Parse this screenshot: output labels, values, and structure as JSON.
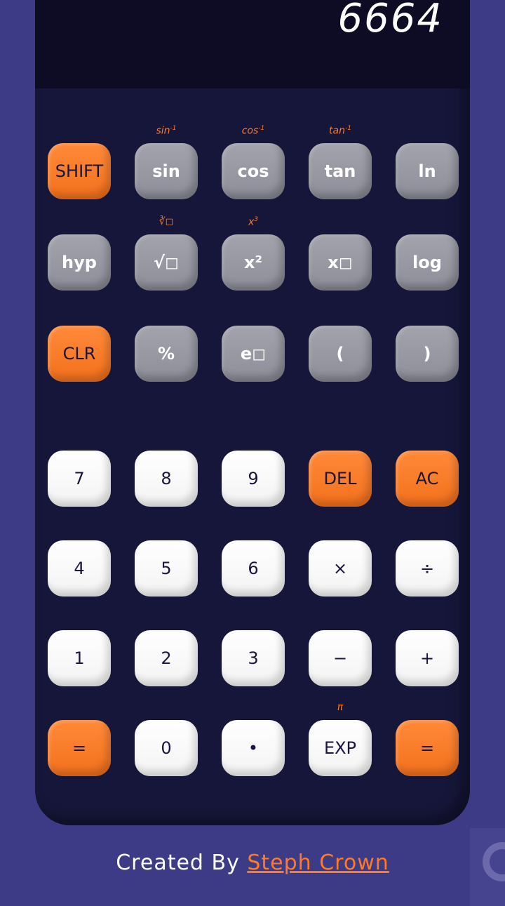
{
  "display": {
    "value": "6664"
  },
  "scientific_rows": [
    [
      {
        "label": "SHIFT",
        "style": "orange",
        "name": "shift-button"
      },
      {
        "label": "sin",
        "style": "gray",
        "name": "sin-button",
        "shift": "sin",
        "shift_sup": "-1"
      },
      {
        "label": "cos",
        "style": "gray",
        "name": "cos-button",
        "shift": "cos",
        "shift_sup": "-1"
      },
      {
        "label": "tan",
        "style": "gray",
        "name": "tan-button",
        "shift": "tan",
        "shift_sup": "-1"
      },
      {
        "label": "ln",
        "style": "gray",
        "name": "ln-button"
      }
    ],
    [
      {
        "label": "hyp",
        "style": "gray",
        "name": "hyp-button"
      },
      {
        "label": "√◻",
        "style": "gray",
        "name": "sqrt-button",
        "shift": "∛◻"
      },
      {
        "label": "x²",
        "style": "gray",
        "name": "square-button",
        "shift": "x",
        "shift_sup": "3"
      },
      {
        "label": "x◻",
        "style": "gray",
        "name": "power-button"
      },
      {
        "label": "log",
        "style": "gray",
        "name": "log-button"
      }
    ],
    [
      {
        "label": "CLR",
        "style": "orange",
        "name": "clr-button"
      },
      {
        "label": "%",
        "style": "gray",
        "name": "percent-button"
      },
      {
        "label": "e◻",
        "style": "gray",
        "name": "exp-e-button"
      },
      {
        "label": "(",
        "style": "gray",
        "name": "open-paren-button"
      },
      {
        "label": ")",
        "style": "gray",
        "name": "close-paren-button"
      }
    ]
  ],
  "number_rows": [
    [
      {
        "label": "7",
        "style": "white",
        "name": "digit-7-button"
      },
      {
        "label": "8",
        "style": "white",
        "name": "digit-8-button"
      },
      {
        "label": "9",
        "style": "white",
        "name": "digit-9-button"
      },
      {
        "label": "DEL",
        "style": "orange",
        "name": "del-button"
      },
      {
        "label": "AC",
        "style": "orange",
        "name": "ac-button"
      }
    ],
    [
      {
        "label": "4",
        "style": "white",
        "name": "digit-4-button"
      },
      {
        "label": "5",
        "style": "white",
        "name": "digit-5-button"
      },
      {
        "label": "6",
        "style": "white",
        "name": "digit-6-button"
      },
      {
        "label": "×",
        "style": "white",
        "name": "multiply-button"
      },
      {
        "label": "÷",
        "style": "white",
        "name": "divide-button"
      }
    ],
    [
      {
        "label": "1",
        "style": "white",
        "name": "digit-1-button"
      },
      {
        "label": "2",
        "style": "white",
        "name": "digit-2-button"
      },
      {
        "label": "3",
        "style": "white",
        "name": "digit-3-button"
      },
      {
        "label": "−",
        "style": "white",
        "name": "minus-button"
      },
      {
        "label": "+",
        "style": "white",
        "name": "plus-button"
      }
    ],
    [
      {
        "label": "=",
        "style": "orange",
        "name": "equals-left-button"
      },
      {
        "label": "0",
        "style": "white",
        "name": "digit-0-button"
      },
      {
        "label": "•",
        "style": "white",
        "name": "decimal-button"
      },
      {
        "label": "EXP",
        "style": "white",
        "name": "exp-button",
        "shift": "π"
      },
      {
        "label": "=",
        "style": "orange",
        "name": "equals-button"
      }
    ]
  ],
  "footer": {
    "prefix": "Created By ",
    "author": "Steph Crown"
  }
}
